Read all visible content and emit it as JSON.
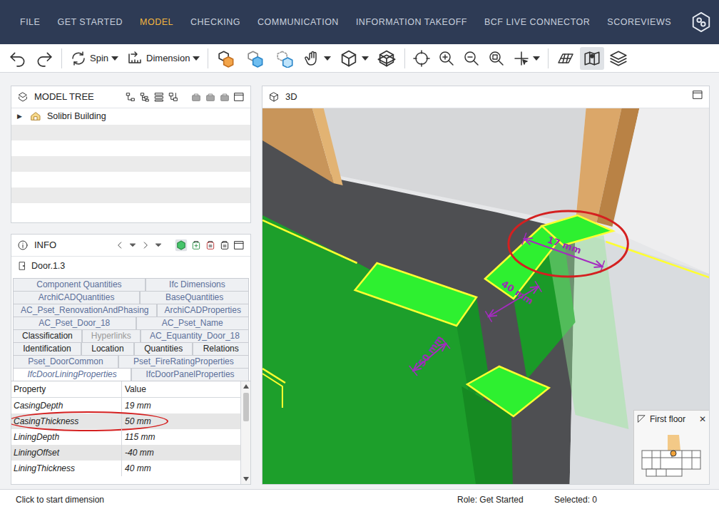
{
  "menu": {
    "tabs": [
      {
        "label": "FILE",
        "selected": false
      },
      {
        "label": "GET STARTED",
        "selected": false
      },
      {
        "label": "MODEL",
        "selected": true
      },
      {
        "label": "CHECKING",
        "selected": false
      },
      {
        "label": "COMMUNICATION",
        "selected": false
      },
      {
        "label": "INFORMATION TAKEOFF",
        "selected": false
      },
      {
        "label": "BCF LIVE CONNECTOR",
        "selected": false
      },
      {
        "label": "SCOREVIEWS",
        "selected": false
      }
    ]
  },
  "toolbar": {
    "tools": [
      "Spin",
      "Dimension"
    ],
    "floor_map_on": true
  },
  "model_tree": {
    "title": "MODEL TREE",
    "items": [
      {
        "label": "Solibri Building",
        "toggle": "▶",
        "expanded": false
      }
    ]
  },
  "info": {
    "title": "INFO",
    "object": "Door.1.3",
    "tab_rows": [
      [
        {
          "label": "Component Quantities",
          "selected": false,
          "front": false,
          "disabled": false
        },
        {
          "label": "Ifc Dimensions",
          "selected": false,
          "front": false,
          "disabled": false
        }
      ],
      [
        {
          "label": "ArchiCADQuantities",
          "selected": false,
          "front": false,
          "disabled": false
        },
        {
          "label": "BaseQuantities",
          "selected": false,
          "front": false,
          "disabled": false
        }
      ],
      [
        {
          "label": "AC_Pset_RenovationAndPhasing",
          "selected": false,
          "front": false,
          "disabled": false
        },
        {
          "label": "ArchiCADProperties",
          "selected": false,
          "front": false,
          "disabled": false
        }
      ],
      [
        {
          "label": "AC_Pset_Door_18",
          "selected": false,
          "front": false,
          "disabled": false
        },
        {
          "label": "AC_Pset_Name",
          "selected": false,
          "front": false,
          "disabled": false
        }
      ],
      [
        {
          "label": "Classification",
          "selected": false,
          "front": true,
          "disabled": false
        },
        {
          "label": "Hyperlinks",
          "selected": false,
          "front": true,
          "disabled": true
        },
        {
          "label": "AC_Equantity_Door_18",
          "selected": false,
          "front": false,
          "disabled": false
        }
      ],
      [
        {
          "label": "Identification",
          "selected": false,
          "front": true,
          "disabled": false
        },
        {
          "label": "Location",
          "selected": false,
          "front": true,
          "disabled": false
        },
        {
          "label": "Quantities",
          "selected": false,
          "front": true,
          "disabled": false
        },
        {
          "label": "Relations",
          "selected": false,
          "front": true,
          "disabled": false
        }
      ],
      [
        {
          "label": "Pset_DoorCommon",
          "selected": false,
          "front": false,
          "disabled": false
        },
        {
          "label": "Pset_FireRatingProperties",
          "selected": false,
          "front": false,
          "disabled": false
        }
      ],
      [
        {
          "label": "IfcDoorLiningProperties",
          "selected": true,
          "front": false,
          "disabled": false
        },
        {
          "label": "IfcDoorPanelProperties",
          "selected": false,
          "front": false,
          "disabled": false
        }
      ]
    ],
    "columns": [
      "Property",
      "Value"
    ],
    "rows": [
      {
        "property": "CasingDepth",
        "value": "19 mm",
        "annotated": false
      },
      {
        "property": "CasingThickness",
        "value": "50 mm",
        "annotated": true
      },
      {
        "property": "LiningDepth",
        "value": "115 mm",
        "annotated": false
      },
      {
        "property": "LiningOffset",
        "value": "-40 mm",
        "annotated": false
      },
      {
        "property": "LiningThickness",
        "value": "40 mm",
        "annotated": false
      }
    ]
  },
  "view": {
    "title": "3D",
    "dimensions": [
      {
        "label": "17 mm",
        "annotated": true
      },
      {
        "label": "40 mm",
        "annotated": false
      },
      {
        "label": "50 mm",
        "annotated": false
      }
    ],
    "minimap": {
      "title": "First floor",
      "close": "✕"
    }
  },
  "status_bar": {
    "hint": "Click to start dimension",
    "role": "Role: Get Started",
    "selected": "Selected: 0"
  }
}
